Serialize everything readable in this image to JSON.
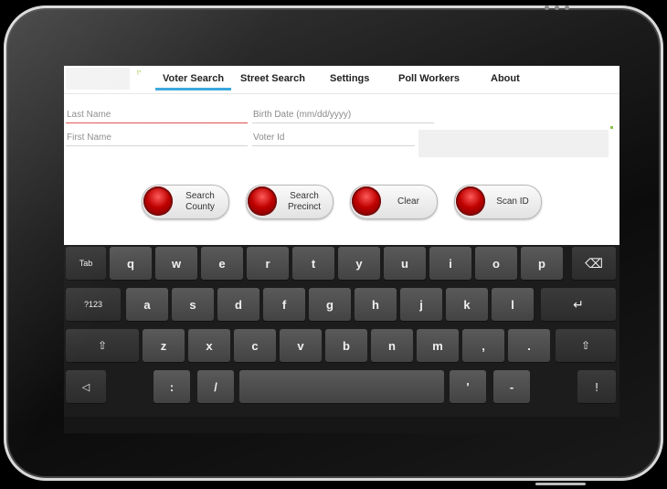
{
  "tabs": [
    {
      "label": "Voter Search",
      "active": true
    },
    {
      "label": "Street Search",
      "active": false
    },
    {
      "label": "Settings",
      "active": false
    },
    {
      "label": "Poll Workers",
      "active": false
    },
    {
      "label": "About",
      "active": false
    }
  ],
  "form": {
    "last_name_placeholder": "Last Name",
    "birth_date_placeholder": "Birth Date (mm/dd/yyyy)",
    "first_name_placeholder": "First Name",
    "voter_id_placeholder": "Voter Id"
  },
  "actions": [
    {
      "label": "Search\nCounty"
    },
    {
      "label": "Search\nPrecinct"
    },
    {
      "label": "Clear"
    },
    {
      "label": "Scan ID"
    }
  ],
  "keyboard": {
    "row1": [
      "Tab",
      "q",
      "w",
      "e",
      "r",
      "t",
      "y",
      "u",
      "i",
      "o",
      "p",
      "⌫"
    ],
    "row2": [
      "?123",
      "a",
      "s",
      "d",
      "f",
      "g",
      "h",
      "j",
      "k",
      "l",
      "↵"
    ],
    "row3": [
      "⇧",
      "z",
      "x",
      "c",
      "v",
      "b",
      "n",
      "m",
      ",",
      ".",
      "⇧"
    ],
    "row4": [
      "◁",
      ":",
      "/",
      "",
      "'",
      "-",
      "!"
    ]
  },
  "colors": {
    "tab_underline": "#39a7dc",
    "focus_underline": "#e05050",
    "button_led": "#c00000"
  }
}
